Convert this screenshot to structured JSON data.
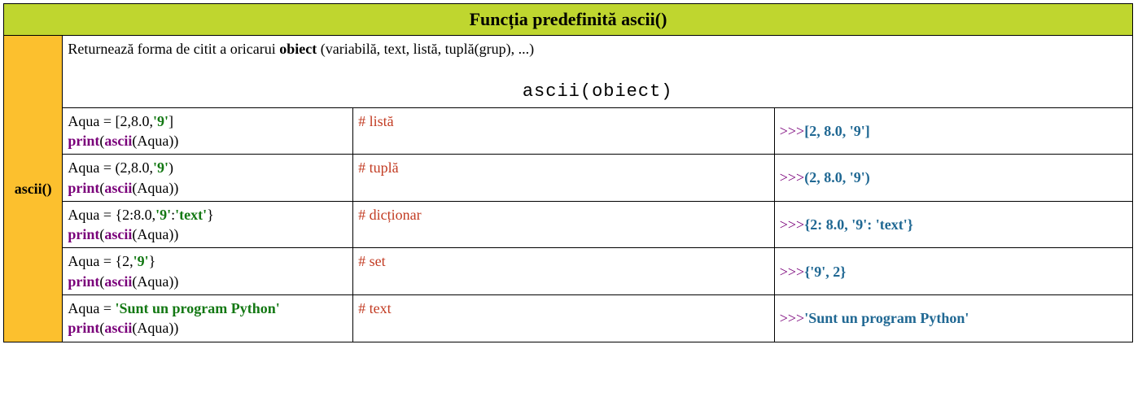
{
  "header": {
    "title": "Funcția predefinită ascii()"
  },
  "fn_name": "ascii()",
  "description": {
    "text_before": "Returnează forma de citit a oricarui ",
    "bold": "obiect",
    "text_after": " (variabilă, text, listă, tuplă(grup), ...)",
    "syntax": "ascii(obiect)"
  },
  "rows": [
    {
      "assign_pre": "Aqua = [2,8.0,",
      "assign_str": "'9'",
      "assign_post": "]",
      "comment": "# listă",
      "print_pre": "print",
      "print_fn": "ascii",
      "print_arg": "(Aqua))",
      "out_prompt": ">>>",
      "out_value": "[2, 8.0, '9']"
    },
    {
      "assign_pre": "Aqua = (2,8.0,",
      "assign_str": "'9'",
      "assign_post": ")",
      "comment": "# tuplă",
      "print_pre": "print",
      "print_fn": "ascii",
      "print_arg": "(Aqua))",
      "out_prompt": ">>>",
      "out_value": "(2, 8.0, '9')"
    },
    {
      "assign_pre": "Aqua = {2:8.0,",
      "assign_str": "'9'",
      "assign_mid": ":",
      "assign_str2": "'text'",
      "assign_post": "}",
      "comment": "# dicționar",
      "print_pre": "print",
      "print_fn": "ascii",
      "print_arg": "(Aqua))",
      "out_prompt": ">>>",
      "out_value": "{2: 8.0, '9': 'text'}"
    },
    {
      "assign_pre": "Aqua = {2,",
      "assign_str": "'9'",
      "assign_post": "}",
      "comment": "# set",
      "print_pre": "print",
      "print_fn": "ascii",
      "print_arg": "(Aqua))",
      "out_prompt": ">>>",
      "out_value": "{'9', 2}"
    },
    {
      "assign_pre": "Aqua = ",
      "assign_str": "'Sunt un program Python'",
      "assign_post": "",
      "comment": "# text",
      "print_pre": "print",
      "print_fn": "ascii",
      "print_arg": "(Aqua))",
      "out_prompt": ">>>",
      "out_value": "'Sunt un program Python'"
    }
  ]
}
